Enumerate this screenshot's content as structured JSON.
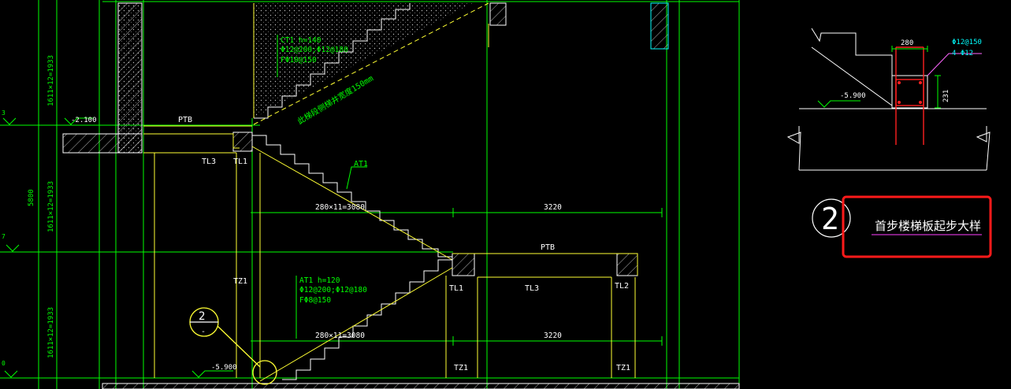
{
  "colors": {
    "background": "#000000",
    "green": "#00ff00",
    "yellow": "#ffff33",
    "white": "#ffffff",
    "cyan": "#00ffff",
    "red": "#ff2020",
    "magenta": "#cc33cc",
    "highlight": "#ff1a1a"
  },
  "dims": {
    "left_top": "1611×12=1933",
    "left_mid": "1611×12=1933",
    "left_bot": "1611×12=1933",
    "total": "5800",
    "level_labels_left": [
      "3",
      "7",
      "0"
    ],
    "run_upper": "280×11=3080",
    "span_upper": "3220",
    "run_lower": "280×11=3080",
    "span_lower": "3220"
  },
  "elevations": {
    "landing": "-2.100",
    "ground": "-5.900",
    "detail": "-5.900"
  },
  "labels": {
    "ptb_upper": "PTB",
    "ptb_lower": "PTB",
    "tl3_upper": "TL3",
    "tl1_upper": "TL1",
    "tl1_lower": "TL1",
    "tl3_lower": "TL3",
    "tl2_lower": "TL2",
    "tz1_left": "TZ1",
    "tz1_mid": "TZ1",
    "tz1_right": "TZ1",
    "at1_upper": "AT1",
    "sloped_note": "此梯段侧梯井宽度150mm"
  },
  "notes": {
    "ct1": [
      "CT1 h=140",
      "Φ12@200;Φ12@180",
      "FΦ10@150"
    ],
    "at1": [
      "AT1 h=120",
      "Φ12@200;Φ12@180",
      "FΦ8@150"
    ]
  },
  "callout": {
    "number": "2",
    "sub": "-"
  },
  "detail": {
    "width": "280",
    "height": "231",
    "rebar_top": "Φ12@150",
    "rebar_bot": "4 Φ12",
    "number": "2",
    "title": "首步楼梯板起步大样"
  }
}
